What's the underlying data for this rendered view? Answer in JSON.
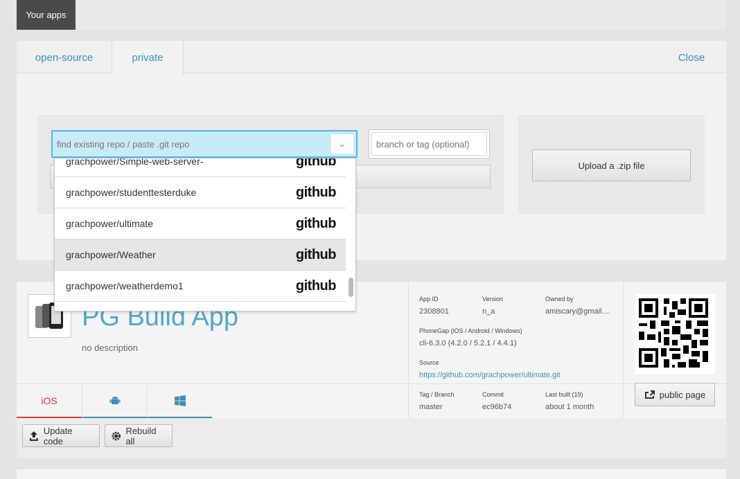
{
  "header": {
    "tab_label": "Your apps"
  },
  "add_panel": {
    "tabs": [
      {
        "label": "open-source"
      },
      {
        "label": "private"
      }
    ],
    "close_label": "Close",
    "repo_search": {
      "placeholder": "find existing repo / paste .git repo"
    },
    "branch": {
      "placeholder": "branch or tag (optional)"
    },
    "upload_zip_label": "Upload a .zip file",
    "repos": [
      {
        "name": "grachpower/Simple-web-server-",
        "source": "github"
      },
      {
        "name": "grachpower/studenttesterduke",
        "source": "github"
      },
      {
        "name": "grachpower/ultimate",
        "source": "github"
      },
      {
        "name": "grachpower/Weather",
        "source": "github"
      },
      {
        "name": "grachpower/weatherdemo1",
        "source": "github"
      }
    ]
  },
  "app": {
    "title": "PG Build App",
    "description": "no description",
    "platforms": [
      {
        "label": "iOS",
        "icon": "apple-icon"
      },
      {
        "label": "",
        "icon": "android-icon"
      },
      {
        "label": "",
        "icon": "windows-icon"
      }
    ],
    "meta": {
      "app_id_label": "App ID",
      "app_id": "2308801",
      "version_label": "Version",
      "version": "n_a",
      "owned_label": "Owned by",
      "owned": "amiscary@gmail....",
      "phonegap_label": "PhoneGap (iOS / Android / Windows)",
      "phonegap": "cli-6.3.0 (4.2.0 / 5.2.1 / 4.4.1)",
      "source_label": "Source",
      "source": "https://github.com/grachpower/ultimate.git",
      "branch_label": "Tag / Branch",
      "branch": "master",
      "commit_label": "Commit",
      "commit": "ec96b74",
      "built_label": "Last built (19)",
      "built": "about 1 month"
    },
    "public_page_label": "public page",
    "update_code_label": "Update code",
    "rebuild_all_label": "Rebuild all"
  },
  "colors": {
    "accent": "#3d8fb3",
    "ios": "#d63c3c",
    "search_bg": "#c8ecf6"
  }
}
